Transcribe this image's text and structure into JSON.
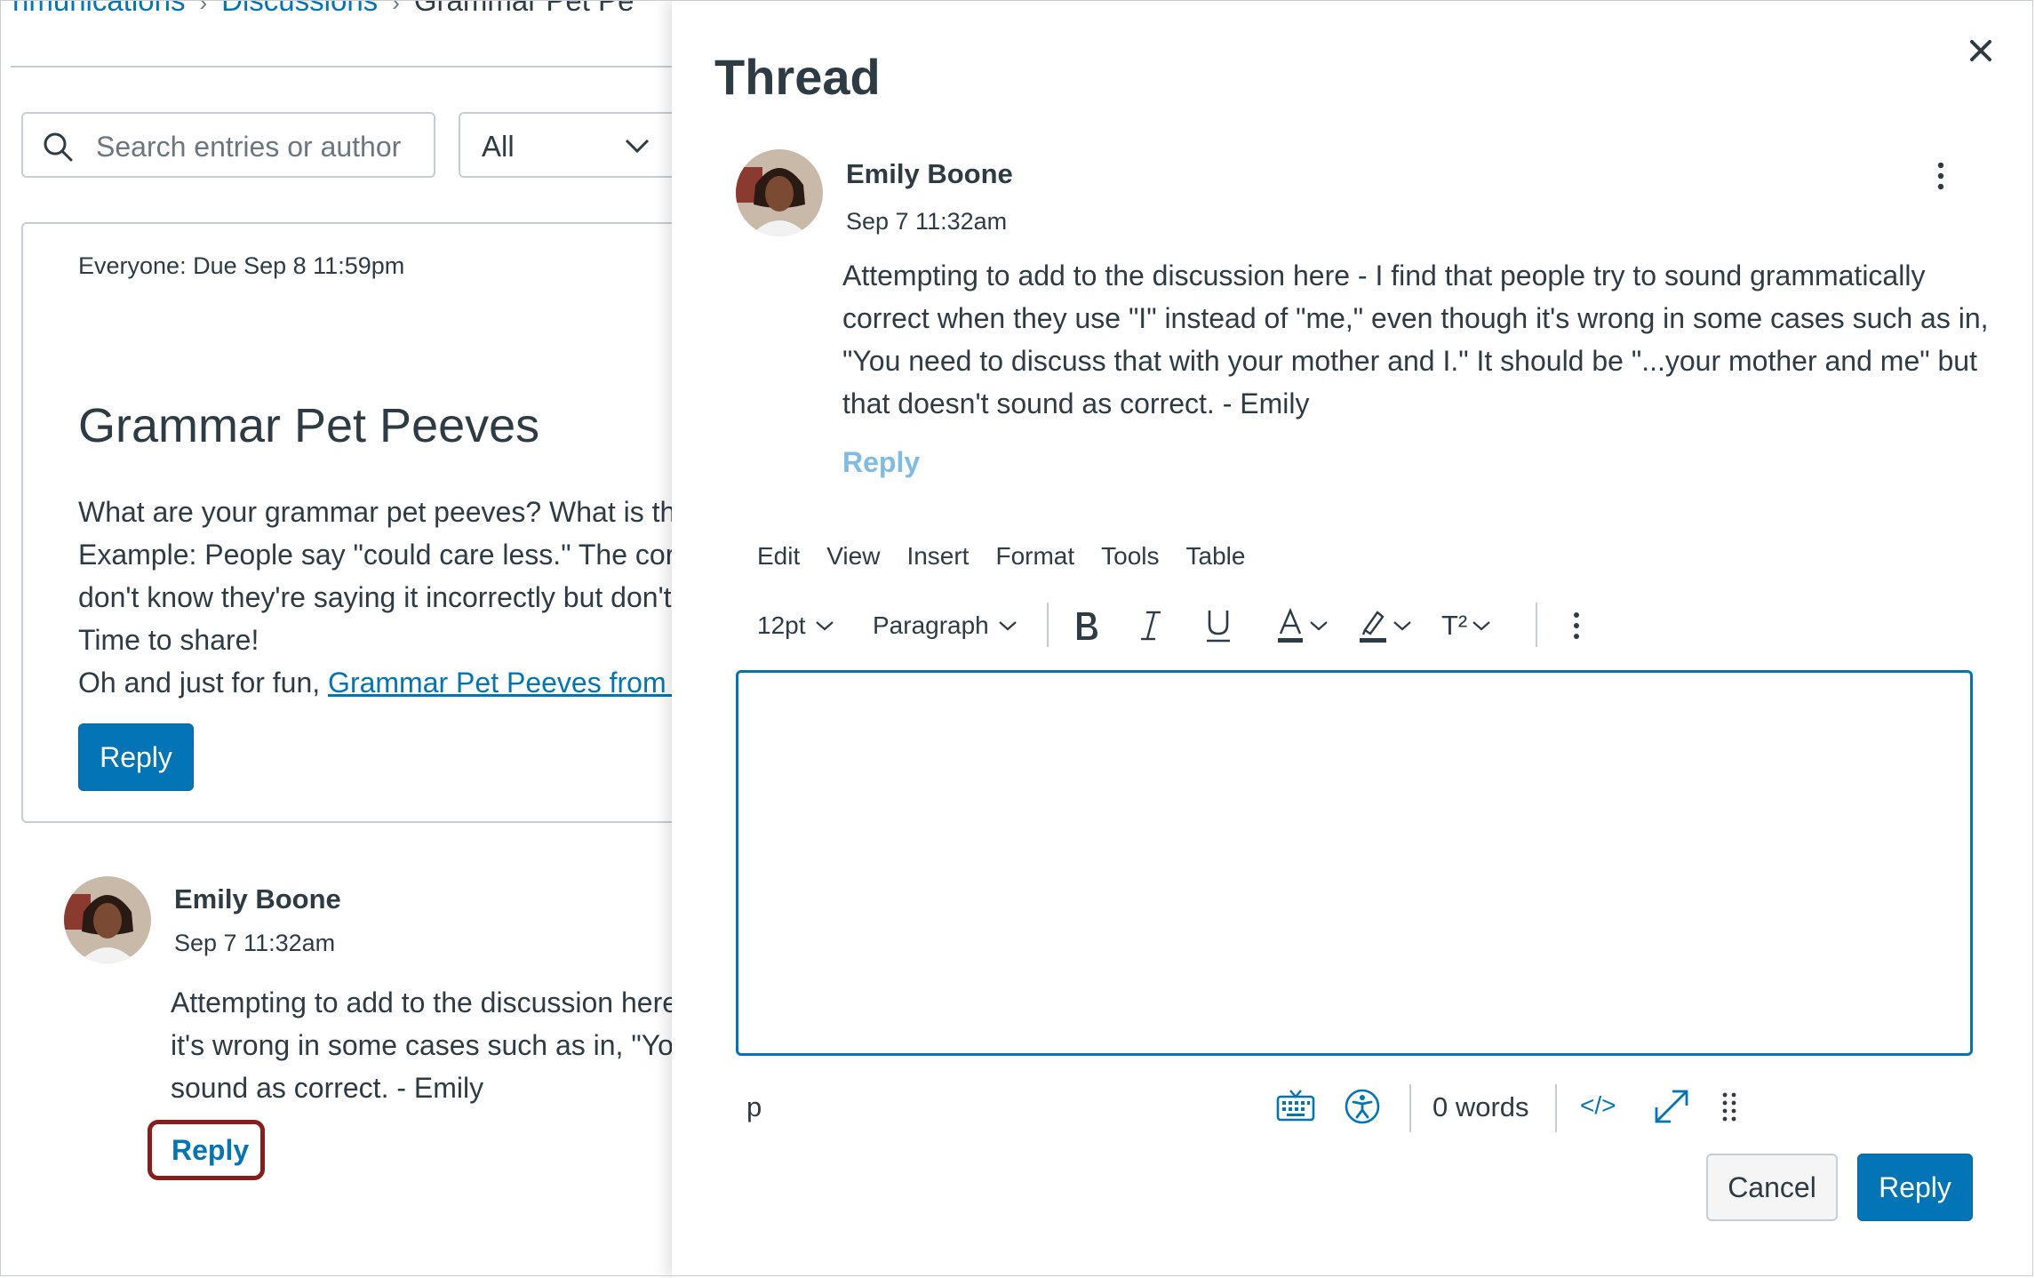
{
  "breadcrumb": {
    "items": [
      "nmunications",
      "Discussions",
      "Grammar Pet Pe"
    ]
  },
  "search": {
    "placeholder": "Search entries or author"
  },
  "filter": {
    "selected": "All"
  },
  "topic": {
    "due": "Everyone: Due Sep 8 11:59pm",
    "title": "Grammar Pet Peeves",
    "body_lines": [
      "What are your grammar pet peeves? What is the",
      "Example: People say \"could care less.\" The correc",
      "don't know they're saying it incorrectly but don't",
      "Time to share!"
    ],
    "link_prefix": "Oh and just for fun, ",
    "link_text": "Grammar Pet Peeves from th",
    "reply_label": "Reply"
  },
  "entry": {
    "author": "Emily Boone",
    "date": "Sep 7 11:32am",
    "body_lines": [
      "Attempting to add to the discussion here",
      "it's wrong in some cases such as in, \"You",
      "sound as correct. - Emily"
    ],
    "reply_label": "Reply"
  },
  "tray": {
    "title": "Thread",
    "entry": {
      "author": "Emily Boone",
      "date": "Sep 7 11:32am",
      "body_lines": [
        "Attempting to add to the discussion here - I find that people try to sound grammatically",
        "correct when they use \"I\" instead of \"me,\" even though it's wrong in some cases such as in,",
        "\"You need to discuss that with your mother and I.\" It should be \"...your mother and me\" but",
        "that doesn't sound as correct. - Emily"
      ],
      "reply_label": "Reply"
    },
    "editor": {
      "menu": [
        "Edit",
        "View",
        "Insert",
        "Format",
        "Tools",
        "Table"
      ],
      "font_size": "12pt",
      "block_format": "Paragraph",
      "superscript_label": "T²",
      "path": "p",
      "word_count": "0 words",
      "code_label": "</>"
    },
    "cancel_label": "Cancel",
    "submit_label": "Reply"
  },
  "colors": {
    "brand": "#0374b5",
    "text": "#2d3b45",
    "border": "#c7cdd1",
    "focus_outline": "#8a1c1c",
    "link_disabled": "#7fbce4"
  }
}
